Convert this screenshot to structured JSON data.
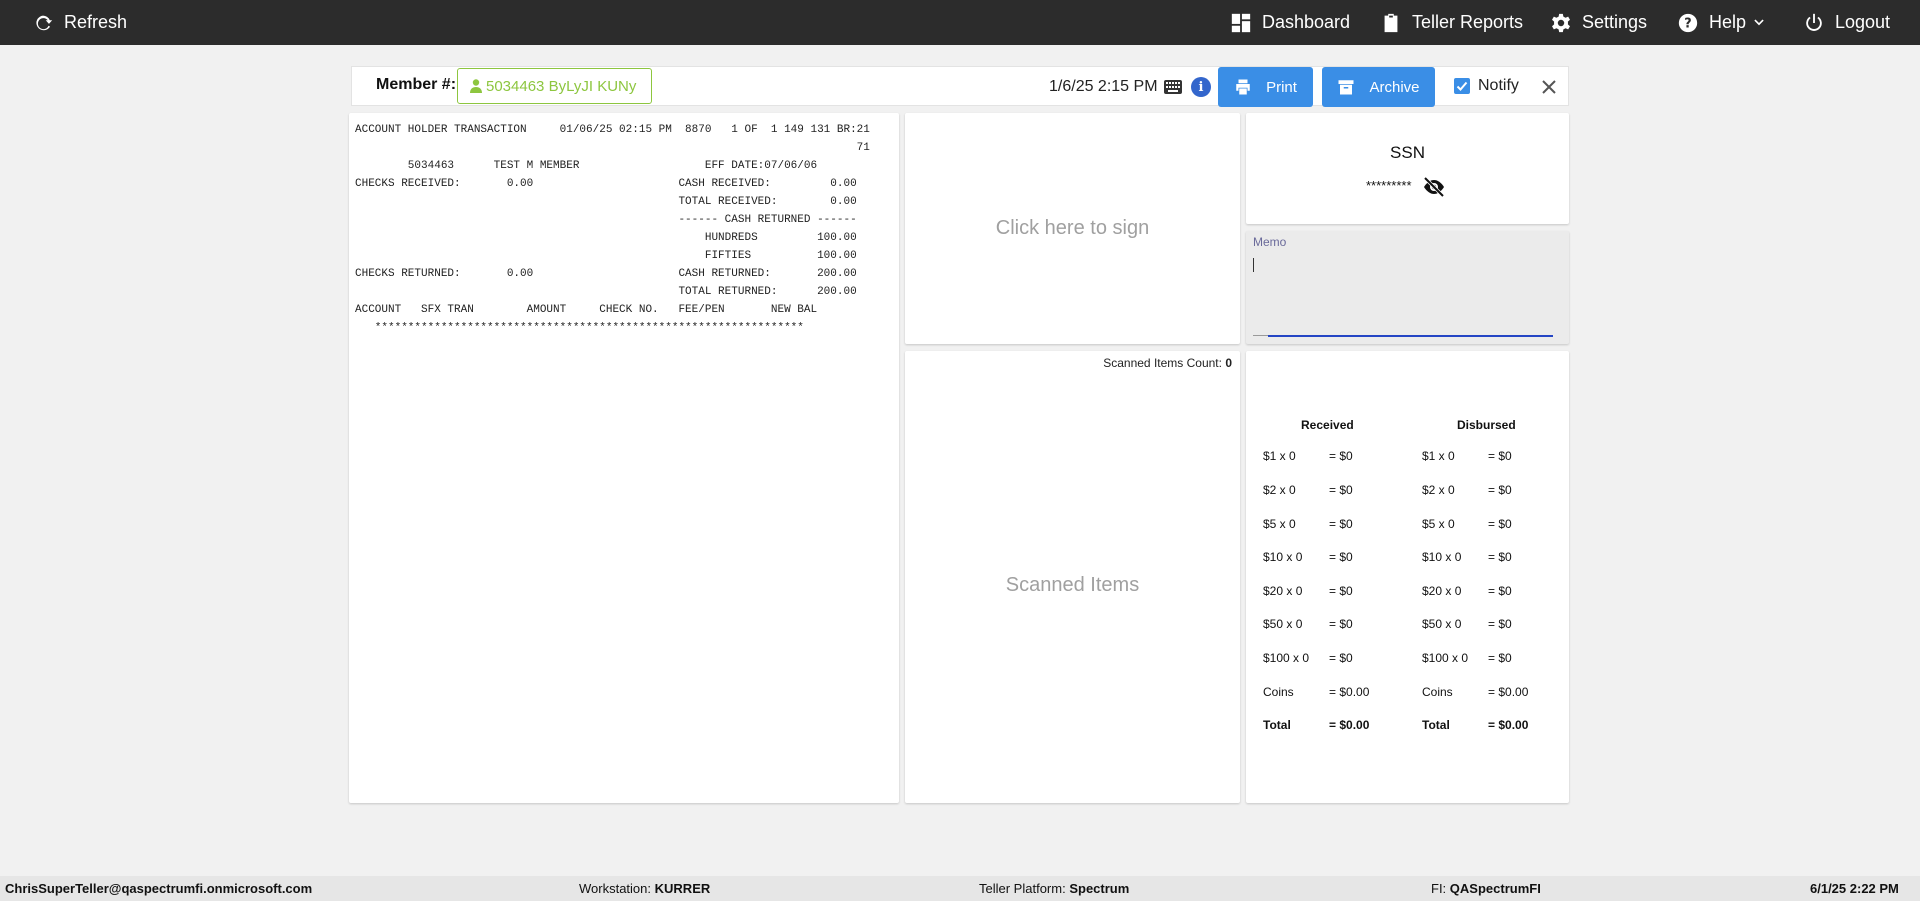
{
  "topbar": {
    "refresh_label": "Refresh",
    "nav": {
      "dashboard": "Dashboard",
      "teller_reports": "Teller Reports",
      "settings": "Settings",
      "help": "Help",
      "logout": "Logout"
    },
    "background_color": "#2c2c2c"
  },
  "header": {
    "member_label": "Member #:",
    "member_value": "5034463 ByLyJI KUNy",
    "datetime": "1/6/25 2:15 PM",
    "print_label": "Print",
    "archive_label": "Archive",
    "notify_label": "Notify",
    "notify_checked": true,
    "accent_color": "#3a8ee6",
    "member_color": "#8dc63f"
  },
  "receipt": {
    "lines": [
      "ACCOUNT HOLDER TRANSACTION     01/06/25 02:15 PM  8870   1 OF  1 149 131 BR:21",
      "                                                                            71",
      "        5034463      TEST M MEMBER                   EFF DATE:07/06/06",
      "CHECKS RECEIVED:       0.00                      CASH RECEIVED:         0.00",
      "                                                 TOTAL RECEIVED:        0.00",
      "                                                 ------ CASH RETURNED ------",
      "                                                     HUNDREDS         100.00",
      "                                                     FIFTIES          100.00",
      "CHECKS RETURNED:       0.00                      CASH RETURNED:       200.00",
      "                                                 TOTAL RETURNED:      200.00",
      "ACCOUNT   SFX TRAN        AMOUNT     CHECK NO.   FEE/PEN       NEW BAL",
      "   *****************************************************************"
    ]
  },
  "signature": {
    "placeholder": "Click here to sign"
  },
  "scanned": {
    "count_label": "Scanned Items Count:",
    "count_value": "0",
    "placeholder": "Scanned Items"
  },
  "ssn": {
    "title": "SSN",
    "masked": "*********"
  },
  "memo": {
    "label": "Memo",
    "value": ""
  },
  "cash": {
    "received_header": "Received",
    "disbursed_header": "Disbursed",
    "received": [
      {
        "denom": "$1 x 0",
        "value": "= $0"
      },
      {
        "denom": "$2 x 0",
        "value": "= $0"
      },
      {
        "denom": "$5 x 0",
        "value": "= $0"
      },
      {
        "denom": "$10 x 0",
        "value": "= $0"
      },
      {
        "denom": "$20 x 0",
        "value": "= $0"
      },
      {
        "denom": "$50 x 0",
        "value": "= $0"
      },
      {
        "denom": "$100 x 0",
        "value": "= $0"
      },
      {
        "denom": "Coins",
        "value": "= $0.00"
      },
      {
        "denom": "Total",
        "value": "= $0.00"
      }
    ],
    "disbursed": [
      {
        "denom": "$1 x 0",
        "value": "= $0"
      },
      {
        "denom": "$2 x 0",
        "value": "= $0"
      },
      {
        "denom": "$5 x 0",
        "value": "= $0"
      },
      {
        "denom": "$10 x 0",
        "value": "= $0"
      },
      {
        "denom": "$20 x 0",
        "value": "= $0"
      },
      {
        "denom": "$50 x 0",
        "value": "= $0"
      },
      {
        "denom": "$100 x 0",
        "value": "= $0"
      },
      {
        "denom": "Coins",
        "value": "= $0.00"
      },
      {
        "denom": "Total",
        "value": "= $0.00"
      }
    ]
  },
  "footer": {
    "user": "ChrisSuperTeller@qaspectrumfi.onmicrosoft.com",
    "workstation_label": "Workstation:",
    "workstation_value": "KURRER",
    "platform_label": "Teller Platform:",
    "platform_value": "Spectrum",
    "fi_label": "FI:",
    "fi_value": "QASpectrumFI",
    "datetime": "6/1/25 2:22 PM"
  }
}
